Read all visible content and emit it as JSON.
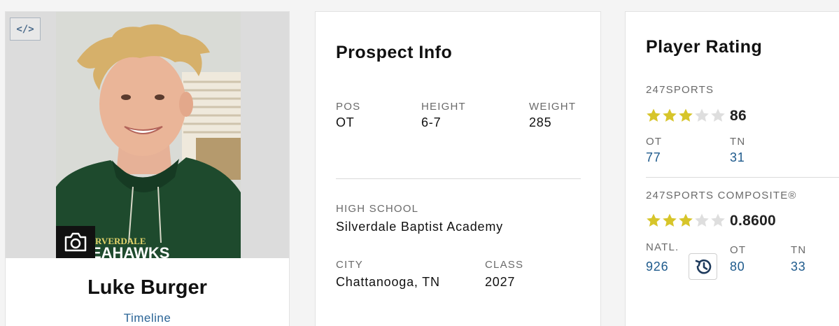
{
  "player": {
    "embed_label": "</>",
    "name": "Luke Burger",
    "timeline_label": "Timeline",
    "shirt_text_1": "RVERDALE",
    "shirt_text_2": "EAHAWKS"
  },
  "prospect": {
    "title": "Prospect Info",
    "pos_label": "POS",
    "pos_value": "OT",
    "height_label": "HEIGHT",
    "height_value": "6-7",
    "weight_label": "WEIGHT",
    "weight_value": "285",
    "school_label": "HIGH SCHOOL",
    "school_value": "Silverdale Baptist Academy",
    "city_label": "CITY",
    "city_value": "Chattanooga, TN",
    "class_label": "CLASS",
    "class_value": "2027"
  },
  "rating": {
    "title": "Player Rating",
    "sports247": {
      "label": "247SPORTS",
      "stars": 3,
      "max_stars": 5,
      "score": "86",
      "ranks": [
        {
          "label": "OT",
          "value": "77"
        },
        {
          "label": "TN",
          "value": "31"
        }
      ]
    },
    "composite": {
      "label": "247SPORTS COMPOSITE®",
      "stars": 3,
      "max_stars": 5,
      "score": "0.8600",
      "ranks": [
        {
          "label": "NATL.",
          "value": "926"
        },
        {
          "label": "OT",
          "value": "80"
        },
        {
          "label": "TN",
          "value": "33"
        }
      ]
    }
  },
  "colors": {
    "star_filled": "#d7c52a",
    "star_empty": "#dedede",
    "link": "#2a6496"
  }
}
